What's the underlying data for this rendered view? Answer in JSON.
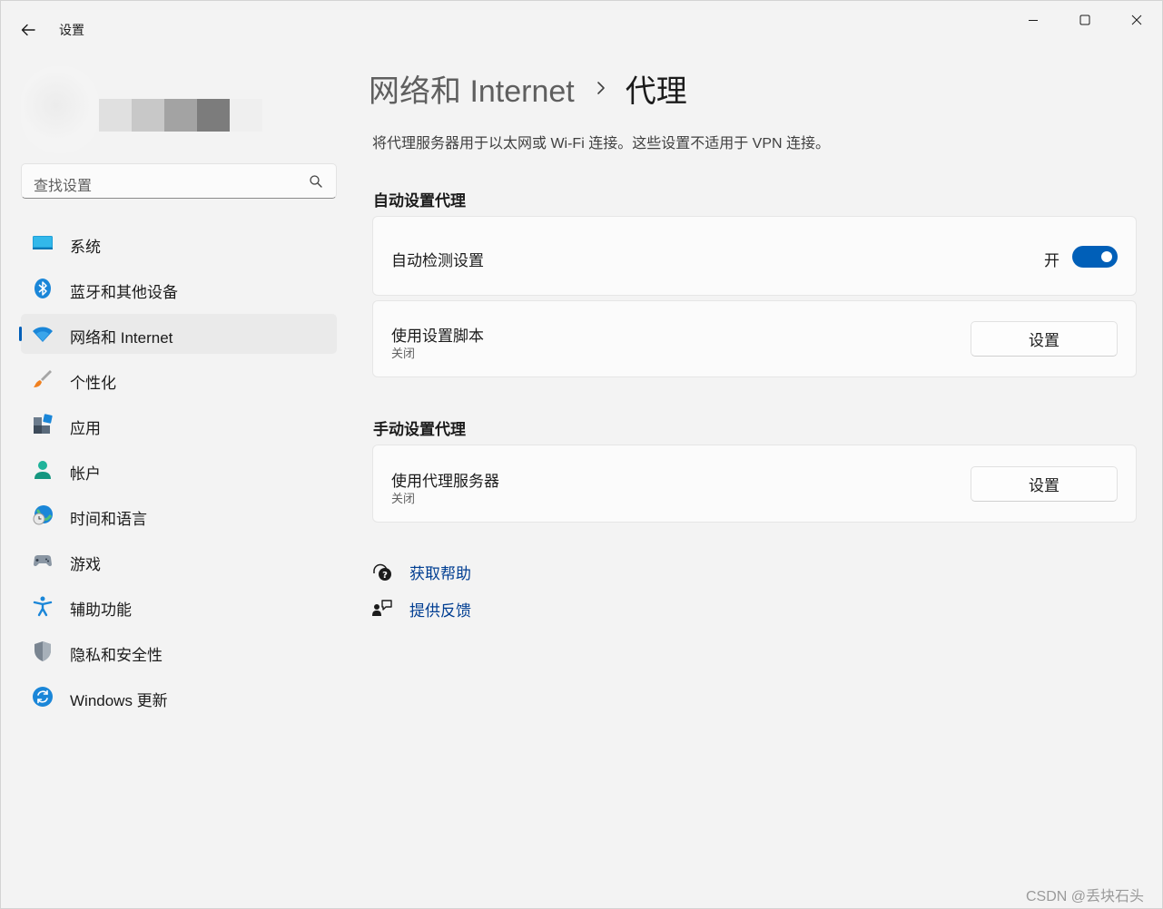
{
  "window": {
    "title": "设置"
  },
  "search": {
    "placeholder": "查找设置"
  },
  "sidebar": {
    "items": [
      {
        "label": "系统",
        "icon": "monitor-icon"
      },
      {
        "label": "蓝牙和其他设备",
        "icon": "bluetooth-icon"
      },
      {
        "label": "网络和 Internet",
        "icon": "wifi-icon",
        "selected": true
      },
      {
        "label": "个性化",
        "icon": "brush-icon"
      },
      {
        "label": "应用",
        "icon": "apps-icon"
      },
      {
        "label": "帐户",
        "icon": "account-icon"
      },
      {
        "label": "时间和语言",
        "icon": "globe-clock-icon"
      },
      {
        "label": "游戏",
        "icon": "gamepad-icon"
      },
      {
        "label": "辅助功能",
        "icon": "accessibility-icon"
      },
      {
        "label": "隐私和安全性",
        "icon": "shield-icon"
      },
      {
        "label": "Windows 更新",
        "icon": "update-icon"
      }
    ]
  },
  "page": {
    "breadcrumb_parent": "网络和 Internet",
    "breadcrumb_current": "代理",
    "description": "将代理服务器用于以太网或 Wi-Fi 连接。这些设置不适用于 VPN 连接。"
  },
  "auto_section": {
    "title": "自动设置代理",
    "detect": {
      "label": "自动检测设置",
      "state_label": "开",
      "on": true
    },
    "script": {
      "label": "使用设置脚本",
      "status": "关闭",
      "button": "设置"
    }
  },
  "manual_section": {
    "title": "手动设置代理",
    "proxy": {
      "label": "使用代理服务器",
      "status": "关闭",
      "button": "设置"
    }
  },
  "links": {
    "help": "获取帮助",
    "feedback": "提供反馈"
  },
  "watermark": "CSDN @丢块石头",
  "colors": {
    "accent": "#005fb8",
    "link": "#003e92",
    "background": "#f3f3f3",
    "card": "#fbfbfb"
  }
}
